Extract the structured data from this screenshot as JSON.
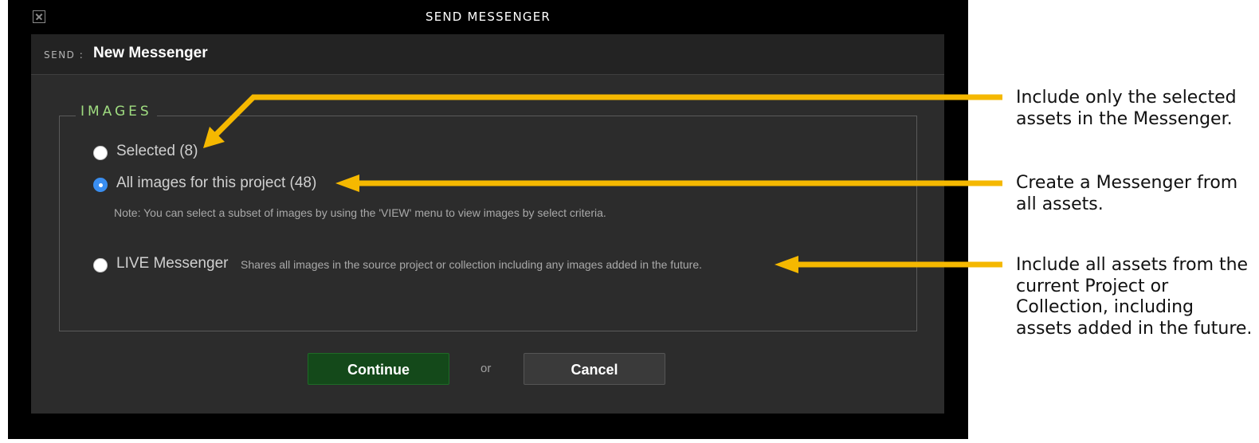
{
  "dialog": {
    "title": "SEND MESSENGER",
    "close_icon": "close-icon"
  },
  "header": {
    "send_label": "SEND :",
    "messenger_name": "New Messenger"
  },
  "images_section": {
    "legend": "IMAGES",
    "options": [
      {
        "label": "Selected (8)",
        "checked": false
      },
      {
        "label": "All images for this project (48)",
        "checked": true
      },
      {
        "label": "LIVE Messenger",
        "checked": false
      }
    ],
    "note": "Note: You can select a subset of images by using the 'VIEW' menu to view images by select criteria.",
    "live_description": "Shares all images in the source project or collection including any images added in the future."
  },
  "buttons": {
    "continue": "Continue",
    "or": "or",
    "cancel": "Cancel"
  },
  "callouts": [
    "Include only the selected assets in the Messenger.",
    "Create a Messenger from all assets.",
    "Include all assets from the current Project or Collection, including assets added in the future."
  ],
  "colors": {
    "arrow": "#f5b800",
    "legend": "#9fdc80",
    "radio_checked": "#3a8ef0",
    "continue_bg": "#14491a"
  }
}
